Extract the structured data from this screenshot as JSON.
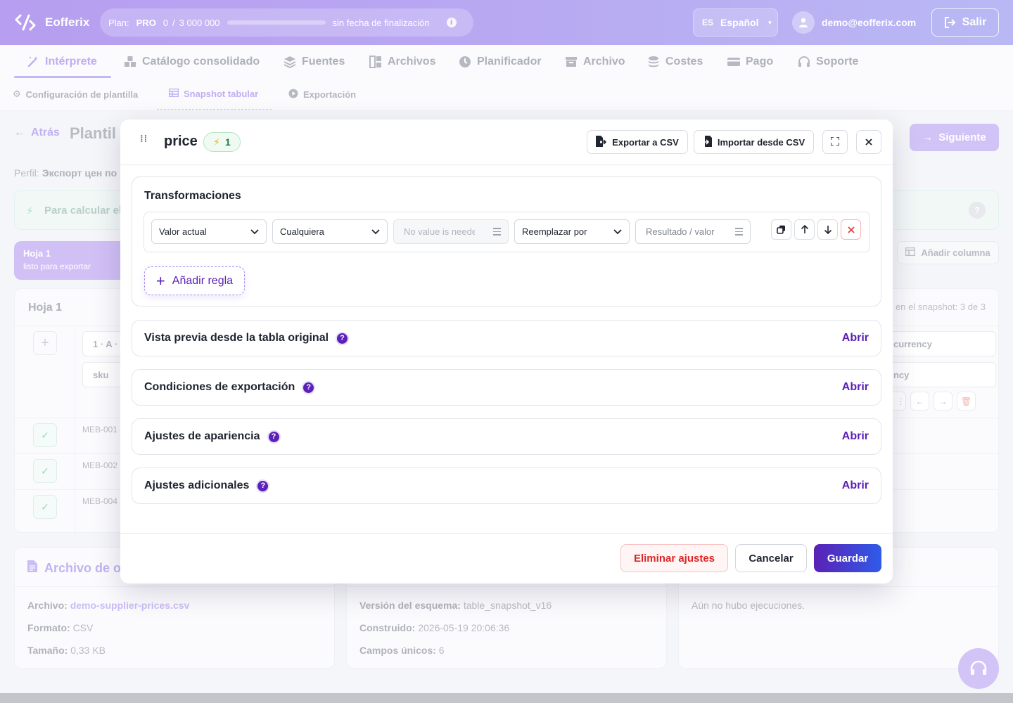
{
  "app": {
    "name": "Eofferix",
    "plan_label": "Plan:",
    "plan_name": "PRO",
    "usage_used": "0",
    "usage_separator": "/",
    "usage_total": "3 000 000",
    "usage_fraction": 0,
    "expiry": "sin fecha de finalización",
    "lang_code": "ES",
    "lang_name": "Español",
    "user_email": "demo@eofferix.com",
    "logout_label": "Salir"
  },
  "tabs": [
    {
      "label": "Intérprete",
      "icon": "magic-wand-icon"
    },
    {
      "label": "Catálogo consolidado",
      "icon": "boxes-icon"
    },
    {
      "label": "Fuentes",
      "icon": "layers-icon"
    },
    {
      "label": "Archivos",
      "icon": "files-icon"
    },
    {
      "label": "Planificador",
      "icon": "clock-icon"
    },
    {
      "label": "Archivo",
      "icon": "archive-icon"
    },
    {
      "label": "Costes",
      "icon": "coins-icon"
    },
    {
      "label": "Pago",
      "icon": "card-icon"
    },
    {
      "label": "Soporte",
      "icon": "headset-icon"
    }
  ],
  "subtabs": [
    {
      "label": "Configuración de plantilla",
      "icon": "gear-icon"
    },
    {
      "label": "Snapshot tabular",
      "icon": "table-icon"
    },
    {
      "label": "Exportación",
      "icon": "play-icon"
    }
  ],
  "page": {
    "back_label": "Atrás",
    "title_partial": "Plantil",
    "next_label": "Siguiente",
    "profile_label": "Perfil:",
    "profile_value": "Экспорт цен по",
    "alert_text": "Para calcular el",
    "sheet_name": "Hoja 1",
    "sheet_status": "listo para exportar",
    "add_column": "Añadir columna",
    "table_title": "Hoja 1",
    "snapshot_count": "en el snapshot: 3 de 3",
    "col1_head": "1 · A ·",
    "col1_sub": "sku",
    "col_right_head": "currency",
    "col_right_sub": "ncy",
    "rows": [
      "MEB-001",
      "MEB-002",
      "MEB-004"
    ],
    "file_card_title": "Archivo de o",
    "file_label": "Archivo:",
    "file_name": "demo-supplier-prices.csv",
    "format_label": "Formato:",
    "format_value": "CSV",
    "size_label": "Tamaño:",
    "size_value": "0,33 KB",
    "schema_label": "Versión del esquema:",
    "schema_value": "table_snapshot_v16",
    "built_label": "Construido:",
    "built_value": "2026-05-19 20:06:36",
    "fields_label": "Campos únicos:",
    "fields_value": "6",
    "runs_text": "Aún no hubo ejecuciones."
  },
  "modal": {
    "title": "price",
    "badge_count": "1",
    "export_csv": "Exportar a CSV",
    "import_csv": "Importar desde CSV",
    "transformations_title": "Transformaciones",
    "rule": {
      "source": "Valor actual",
      "condition": "Cualquiera",
      "condition_value_placeholder": "No value is needed",
      "action": "Reemplazar por",
      "result_placeholder": "Resultado / valor"
    },
    "add_rule": "Añadir regla",
    "sections": [
      {
        "title": "Vista previa desde la tabla original",
        "action": "Abrir"
      },
      {
        "title": "Condiciones de exportación",
        "action": "Abrir"
      },
      {
        "title": "Ajustes de apariencia",
        "action": "Abrir"
      },
      {
        "title": "Ajustes adicionales",
        "action": "Abrir"
      }
    ],
    "delete_label": "Eliminar ajustes",
    "cancel_label": "Cancelar",
    "save_label": "Guardar"
  },
  "colors": {
    "accent": "#5b21b6",
    "header_gradient_start": "#b79ef0",
    "danger": "#dc2626"
  }
}
